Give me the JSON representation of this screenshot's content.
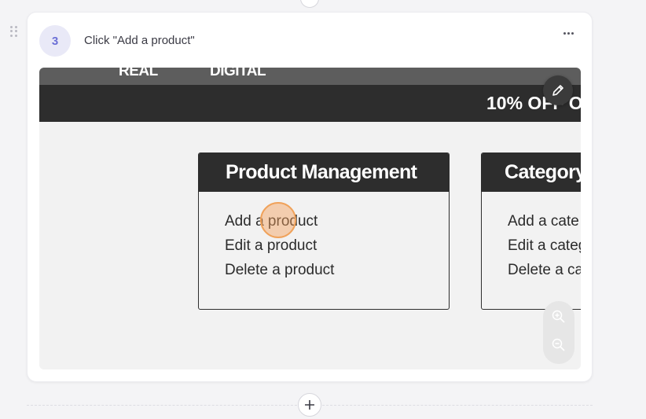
{
  "step": {
    "number": "3",
    "title": "Click \"Add a product\""
  },
  "screenshot": {
    "nav_items": [
      "REAL",
      "DIGITAL"
    ],
    "banner": "10% OFF O",
    "product_card": {
      "title": "Product Management",
      "links": [
        "Add a product",
        "Edit a product",
        "Delete a product"
      ]
    },
    "category_card": {
      "title": "Category",
      "links": [
        "Add a cate",
        "Edit a categ",
        "Delete a ca"
      ]
    }
  },
  "icons": {
    "drag": "drag-handle-icon",
    "more": "more-horizontal-icon",
    "edit": "pencil-icon",
    "zoom_in": "zoom-in-icon",
    "zoom_out": "zoom-out-icon",
    "add": "plus-icon"
  },
  "colors": {
    "accent": "#6b6fd6",
    "badge_bg": "#e9e9f7",
    "dark_header": "#2d2d2d",
    "click_marker": "#f0a25a"
  }
}
